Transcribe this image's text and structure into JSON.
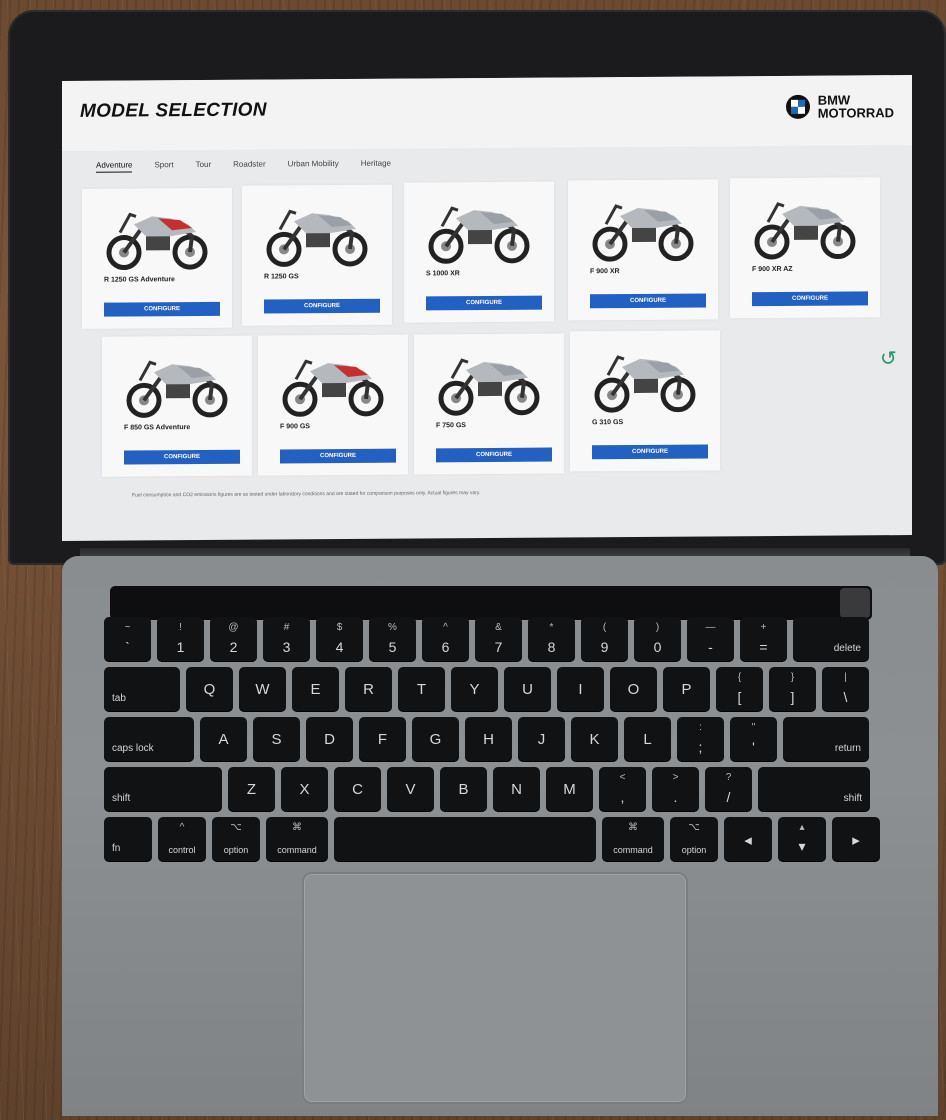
{
  "page": {
    "title": "MODEL SELECTION",
    "brand_line1": "BMW",
    "brand_line2": "MOTORRAD",
    "tabs": [
      "Adventure",
      "Sport",
      "Tour",
      "Roadster",
      "Urban Mobility",
      "Heritage"
    ],
    "button_label": "CONFIGURE",
    "models": [
      {
        "name": "R 1250 GS Adventure",
        "accent": "#c43030"
      },
      {
        "name": "R 1250 GS",
        "accent": "#9aa0a6"
      },
      {
        "name": "S 1000 XR",
        "accent": "#9aa0a6"
      },
      {
        "name": "F 900 XR",
        "accent": "#9aa0a6"
      },
      {
        "name": "F 900 XR AZ",
        "accent": "#9aa0a6"
      },
      {
        "name": "F 850 GS Adventure",
        "accent": "#9aa0a6"
      },
      {
        "name": "F 900 GS",
        "accent": "#c43030"
      },
      {
        "name": "F 750 GS",
        "accent": "#9aa0a6"
      },
      {
        "name": "G 310 GS",
        "accent": "#9aa0a6"
      }
    ],
    "footer_note": "Fuel consumption and CO2 emissions figures are as tested under laboratory conditions and are stated for comparison purposes only. Actual figures may vary."
  },
  "keyboard": {
    "row1": [
      [
        "~",
        "`"
      ],
      [
        "!",
        "1"
      ],
      [
        "@",
        "2"
      ],
      [
        "#",
        "3"
      ],
      [
        "$",
        "4"
      ],
      [
        "%",
        "5"
      ],
      [
        "^",
        "6"
      ],
      [
        "&",
        "7"
      ],
      [
        "*",
        "8"
      ],
      [
        "(",
        "9"
      ],
      [
        ")",
        "0"
      ],
      [
        "—",
        "-"
      ],
      [
        "+",
        "="
      ]
    ],
    "row1_end": "delete",
    "row2_start": "tab",
    "row2": [
      "Q",
      "W",
      "E",
      "R",
      "T",
      "Y",
      "U",
      "I",
      "O",
      "P"
    ],
    "row2_sym": [
      [
        "{",
        "["
      ],
      [
        "}",
        "]"
      ],
      [
        "|",
        "\\"
      ]
    ],
    "row3_start": "caps lock",
    "row3": [
      "A",
      "S",
      "D",
      "F",
      "G",
      "H",
      "J",
      "K",
      "L"
    ],
    "row3_sym": [
      [
        ":",
        ";"
      ],
      [
        "\"",
        "'"
      ]
    ],
    "row3_end": "return",
    "row4_start": "shift",
    "row4": [
      "Z",
      "X",
      "C",
      "V",
      "B",
      "N",
      "M"
    ],
    "row4_sym": [
      [
        "<",
        ","
      ],
      [
        ">",
        "."
      ],
      [
        "?",
        "/"
      ]
    ],
    "row4_end": "shift",
    "row5": {
      "fn": "fn",
      "control": "control",
      "option": "option",
      "command": "command",
      "command_r": "command",
      "option_r": "option"
    }
  },
  "colors": {
    "accent": "#2260c2",
    "screen_bg": "#e9eaec"
  }
}
